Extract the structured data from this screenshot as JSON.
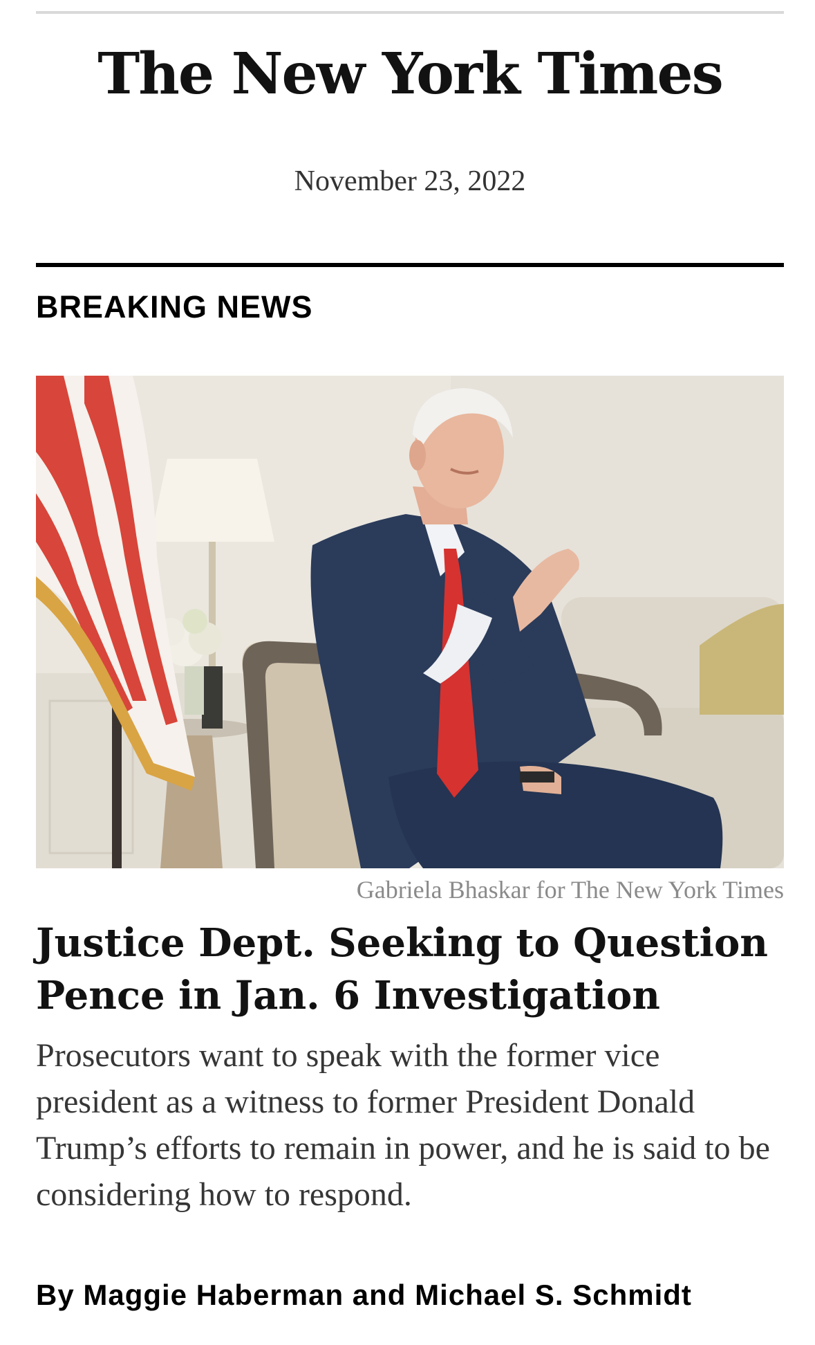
{
  "header": {
    "masthead": "The New York Times",
    "date": "November 23, 2022"
  },
  "section": {
    "kicker": "BREAKING NEWS"
  },
  "article": {
    "photo_credit": "Gabriela Bhaskar for The New York Times",
    "headline": "Justice Dept. Seeking to Question Pence in Jan. 6 Investigation",
    "summary": "Prosecutors want to speak with the former vice president as a witness to former President Donald Trump’s efforts to remain in power, and he is said to be considering how to respond.",
    "byline": "By Maggie Haberman and Michael S. Schmidt"
  },
  "colors": {
    "text": "#121212",
    "credit": "#8a8a8a",
    "rule": "#000000"
  }
}
